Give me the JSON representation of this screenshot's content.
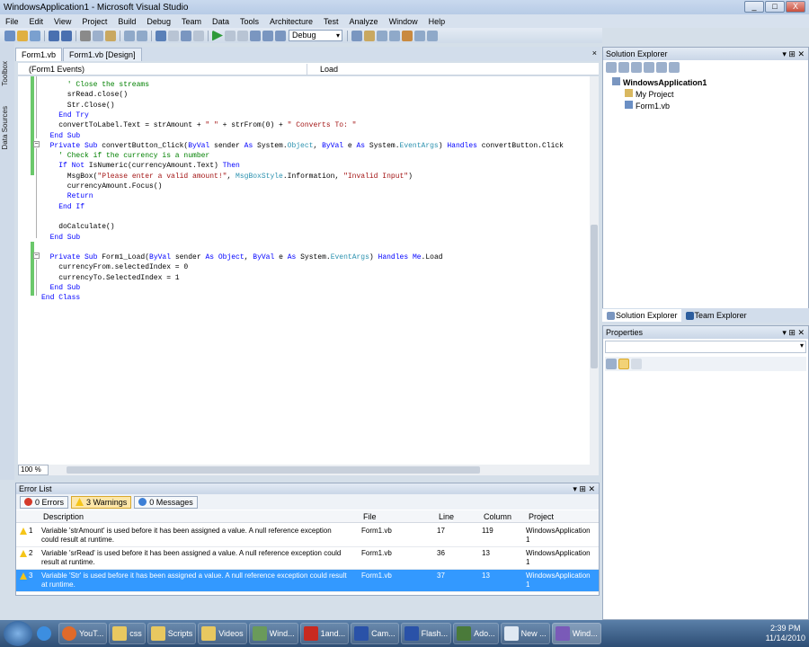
{
  "window": {
    "title": "WindowsApplication1 - Microsoft Visual Studio",
    "min": "_",
    "max": "□",
    "close": "X"
  },
  "menu": [
    "File",
    "Edit",
    "View",
    "Project",
    "Build",
    "Debug",
    "Team",
    "Data",
    "Tools",
    "Architecture",
    "Test",
    "Analyze",
    "Window",
    "Help"
  ],
  "toolbar": {
    "config": "Debug"
  },
  "sidetabs": {
    "toolbox": "Toolbox",
    "datasources": "Data Sources"
  },
  "doctabs": {
    "tab1": "Form1.vb",
    "tab2": "Form1.vb [Design]"
  },
  "nav": {
    "left": "(Form1 Events)",
    "right": "Load"
  },
  "code": [
    {
      "indent": 6,
      "parts": [
        [
          "cm",
          "' Close the streams"
        ]
      ]
    },
    {
      "indent": 6,
      "parts": [
        [
          "",
          "srRead.close()"
        ]
      ]
    },
    {
      "indent": 6,
      "parts": [
        [
          "",
          "Str.Close()"
        ]
      ]
    },
    {
      "indent": 4,
      "parts": [
        [
          "kw",
          "End Try"
        ]
      ]
    },
    {
      "indent": 4,
      "parts": [
        [
          "",
          "convertToLabel.Text = strAmount + "
        ],
        [
          "st",
          "\" \""
        ],
        [
          "",
          " + strFrom(0) + "
        ],
        [
          "st",
          "\" Converts To: \""
        ]
      ]
    },
    {
      "indent": 2,
      "parts": [
        [
          "kw",
          "End Sub"
        ]
      ]
    },
    {
      "indent": 2,
      "parts": [
        [
          "kw",
          "Private Sub "
        ],
        [
          "",
          "convertButton_Click("
        ],
        [
          "kw",
          "ByVal "
        ],
        [
          "",
          "sender "
        ],
        [
          "kw",
          "As "
        ],
        [
          "",
          "System."
        ],
        [
          "ty",
          "Object"
        ],
        [
          "",
          ", "
        ],
        [
          "kw",
          "ByVal "
        ],
        [
          "",
          "e "
        ],
        [
          "kw",
          "As "
        ],
        [
          "",
          "System."
        ],
        [
          "ty",
          "EventArgs"
        ],
        [
          "",
          ") "
        ],
        [
          "kw",
          "Handles "
        ],
        [
          "",
          "convertButton.Click"
        ]
      ]
    },
    {
      "indent": 4,
      "parts": [
        [
          "cm",
          "' Check if the currency is a number"
        ]
      ]
    },
    {
      "indent": 4,
      "parts": [
        [
          "kw",
          "If Not "
        ],
        [
          "",
          "IsNumeric(currencyAmount.Text) "
        ],
        [
          "kw",
          "Then"
        ]
      ]
    },
    {
      "indent": 6,
      "parts": [
        [
          "",
          "MsgBox("
        ],
        [
          "st",
          "\"Please enter a valid amount!\""
        ],
        [
          "",
          ", "
        ],
        [
          "ty",
          "MsgBoxStyle"
        ],
        [
          "",
          ".Information, "
        ],
        [
          "st",
          "\"Invalid Input\""
        ],
        [
          "",
          ")"
        ]
      ]
    },
    {
      "indent": 6,
      "parts": [
        [
          "",
          "currencyAmount.Focus()"
        ]
      ]
    },
    {
      "indent": 6,
      "parts": [
        [
          "kw",
          "Return"
        ]
      ]
    },
    {
      "indent": 4,
      "parts": [
        [
          "kw",
          "End If"
        ]
      ]
    },
    {
      "indent": 0,
      "parts": [
        [
          "",
          ""
        ]
      ]
    },
    {
      "indent": 4,
      "parts": [
        [
          "",
          "doCalculate()"
        ]
      ]
    },
    {
      "indent": 2,
      "parts": [
        [
          "kw",
          "End Sub"
        ]
      ]
    },
    {
      "indent": 0,
      "parts": [
        [
          "",
          ""
        ]
      ]
    },
    {
      "indent": 2,
      "parts": [
        [
          "kw",
          "Private Sub "
        ],
        [
          "",
          "Form1_Load("
        ],
        [
          "kw",
          "ByVal "
        ],
        [
          "",
          "sender "
        ],
        [
          "kw",
          "As Object"
        ],
        [
          "",
          ", "
        ],
        [
          "kw",
          "ByVal "
        ],
        [
          "",
          "e "
        ],
        [
          "kw",
          "As "
        ],
        [
          "",
          "System."
        ],
        [
          "ty",
          "EventArgs"
        ],
        [
          "",
          ") "
        ],
        [
          "kw",
          "Handles Me"
        ],
        [
          "",
          ".Load"
        ]
      ]
    },
    {
      "indent": 4,
      "parts": [
        [
          "",
          "currencyFrom.selectedIndex = 0"
        ]
      ]
    },
    {
      "indent": 4,
      "parts": [
        [
          "",
          "currencyTo.SelectedIndex = 1"
        ]
      ]
    },
    {
      "indent": 2,
      "parts": [
        [
          "kw",
          "End Sub"
        ]
      ]
    },
    {
      "indent": 0,
      "parts": [
        [
          "kw",
          "End Class"
        ]
      ]
    }
  ],
  "zoom": "100 %",
  "errorlist": {
    "title": "Error List",
    "errors": "0 Errors",
    "warnings": "3 Warnings",
    "messages": "0 Messages",
    "columns": {
      "description": "Description",
      "file": "File",
      "line": "Line",
      "column": "Column",
      "project": "Project"
    },
    "rows": [
      {
        "num": "1",
        "desc1": "Variable 'strAmount' is used before it has been assigned a value. A null reference exception",
        "desc2": "could result at runtime.",
        "file": "Form1.vb",
        "line": "17",
        "col": "119",
        "proj1": "WindowsApplication",
        "proj2": "1"
      },
      {
        "num": "2",
        "desc1": "Variable 'srRead' is used before it has been assigned a value. A null reference exception could",
        "desc2": "result at runtime.",
        "file": "Form1.vb",
        "line": "36",
        "col": "13",
        "proj1": "WindowsApplication",
        "proj2": "1"
      },
      {
        "num": "3",
        "desc1": "Variable 'Str' is used before it has been assigned a value. A null reference exception could result",
        "desc2": "at runtime.",
        "file": "Form1.vb",
        "line": "37",
        "col": "13",
        "proj1": "WindowsApplication",
        "proj2": "1"
      }
    ]
  },
  "solution": {
    "title": "Solution Explorer",
    "root": "WindowsApplication1",
    "items": [
      "My Project",
      "Form1.vb"
    ],
    "tab1": "Solution Explorer",
    "tab2": "Team Explorer"
  },
  "properties": {
    "title": "Properties"
  },
  "taskbar": {
    "items": [
      "YouT...",
      "css",
      "Scripts",
      "Videos",
      "Wind...",
      "1and...",
      "Cam...",
      "Flash...",
      "Ado...",
      "New ...",
      "Wind..."
    ],
    "time": "2:39 PM",
    "date": "11/14/2010"
  }
}
